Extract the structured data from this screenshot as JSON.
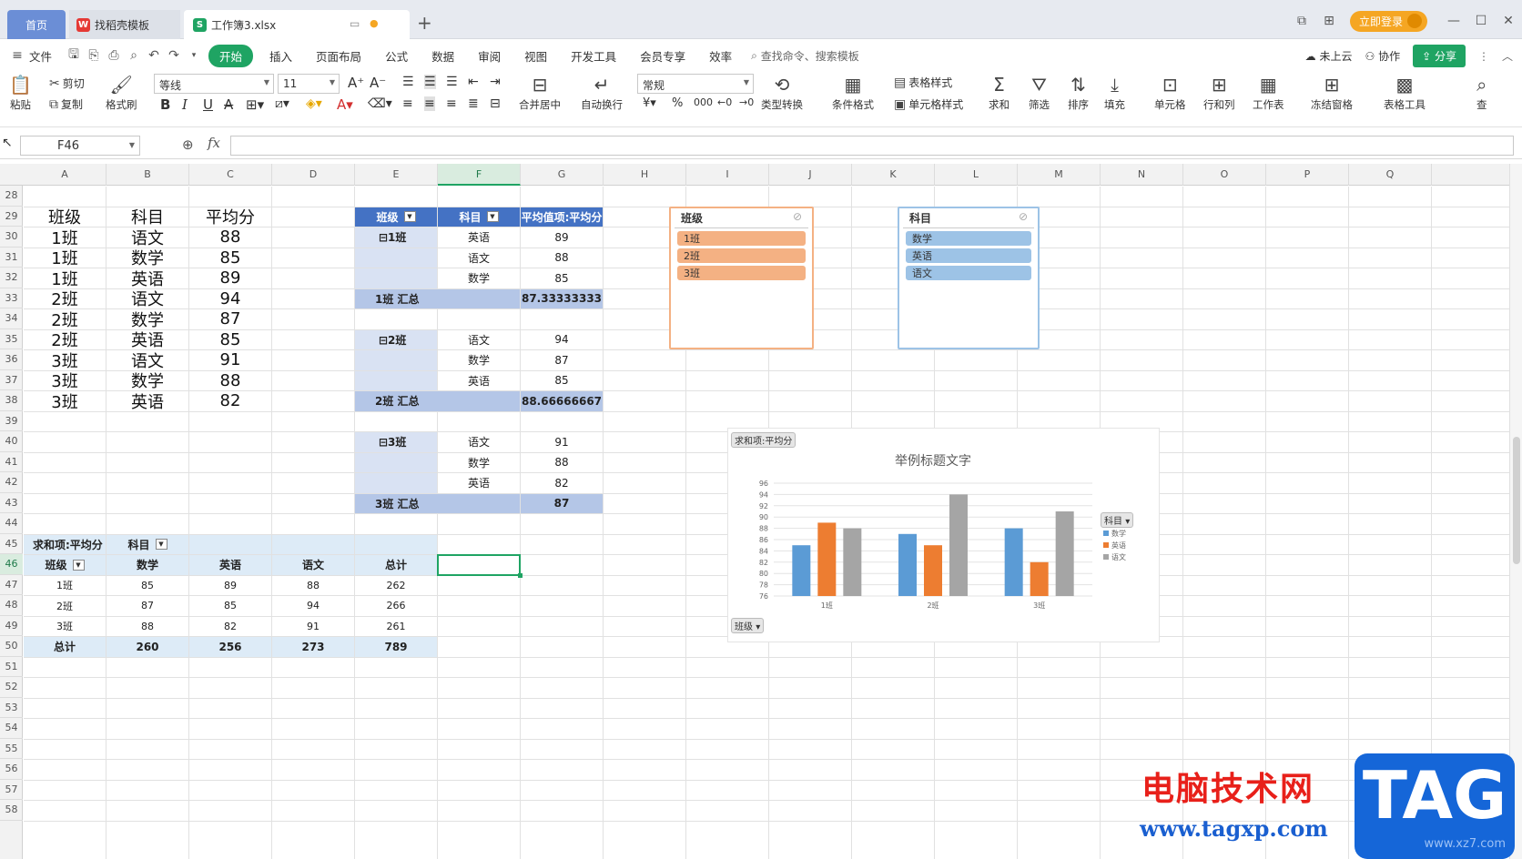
{
  "tabs": {
    "home": "首页",
    "templates": "找稻壳模板",
    "workbook": "工作簿3.xlsx",
    "unsaved_dot": "●",
    "add": "+"
  },
  "window": {
    "login": "立即登录"
  },
  "menu": {
    "file": "文件",
    "items": [
      "开始",
      "插入",
      "页面布局",
      "公式",
      "数据",
      "审阅",
      "视图",
      "开发工具",
      "会员专享",
      "效率"
    ],
    "search": "查找命令、搜索模板",
    "cloud": "未上云",
    "collab": "协作",
    "share": "分享"
  },
  "ribbon": {
    "paste": "粘贴",
    "cut": "剪切",
    "copy": "复制",
    "format_painter": "格式刷",
    "font": "等线",
    "size": "11",
    "number_format": "常规",
    "merge": "合并居中",
    "wrap": "自动换行",
    "convert": "类型转换",
    "cond_format": "条件格式",
    "table_style": "表格样式",
    "cell_style": "单元格样式",
    "sum": "求和",
    "filter": "筛选",
    "sort": "排序",
    "fill": "填充",
    "cell": "单元格",
    "row_col": "行和列",
    "sheet": "工作表",
    "freeze": "冻结窗格",
    "table_tools": "表格工具",
    "find": "查"
  },
  "formula_bar": {
    "name_box": "F46",
    "fx": "fx",
    "value": ""
  },
  "columns": [
    "A",
    "B",
    "C",
    "D",
    "E",
    "F",
    "G",
    "H",
    "I",
    "J",
    "K",
    "L",
    "M",
    "N",
    "O",
    "P",
    "Q"
  ],
  "selected_column": "F",
  "rows": [
    "28",
    "29",
    "30",
    "31",
    "32",
    "33",
    "34",
    "35",
    "36",
    "37",
    "38",
    "39",
    "40",
    "41",
    "42",
    "43",
    "44",
    "45",
    "46",
    "47",
    "48",
    "49",
    "50",
    "51",
    "52",
    "53",
    "54",
    "55",
    "56",
    "57",
    "58"
  ],
  "selected_row": "46",
  "source_table": {
    "headers": [
      "班级",
      "科目",
      "平均分"
    ],
    "rows": [
      [
        "1班",
        "语文",
        "88"
      ],
      [
        "1班",
        "数学",
        "85"
      ],
      [
        "1班",
        "英语",
        "89"
      ],
      [
        "2班",
        "语文",
        "94"
      ],
      [
        "2班",
        "数学",
        "87"
      ],
      [
        "2班",
        "英语",
        "85"
      ],
      [
        "3班",
        "语文",
        "91"
      ],
      [
        "3班",
        "数学",
        "88"
      ],
      [
        "3班",
        "英语",
        "82"
      ]
    ]
  },
  "pivot1": {
    "headers": [
      "班级",
      "科目",
      "平均值项:平均分"
    ],
    "groups": [
      {
        "label": "⊟1班",
        "items": [
          [
            "英语",
            "89"
          ],
          [
            "语文",
            "88"
          ],
          [
            "数学",
            "85"
          ]
        ],
        "total_label": "1班 汇总",
        "total": "87.33333333"
      },
      {
        "label": "⊟2班",
        "items": [
          [
            "语文",
            "94"
          ],
          [
            "数学",
            "87"
          ],
          [
            "英语",
            "85"
          ]
        ],
        "total_label": "2班 汇总",
        "total": "88.66666667"
      },
      {
        "label": "⊟3班",
        "items": [
          [
            "语文",
            "91"
          ],
          [
            "数学",
            "88"
          ],
          [
            "英语",
            "82"
          ]
        ],
        "total_label": "3班 汇总",
        "total": "87"
      }
    ]
  },
  "pivot2": {
    "value_label": "求和项:平均分",
    "col_field": "科目",
    "row_field": "班级",
    "col_headers": [
      "数学",
      "英语",
      "语文",
      "总计"
    ],
    "rows": [
      [
        "1班",
        "85",
        "89",
        "88",
        "262"
      ],
      [
        "2班",
        "87",
        "85",
        "94",
        "266"
      ],
      [
        "3班",
        "88",
        "82",
        "91",
        "261"
      ]
    ],
    "total_row": [
      "总计",
      "260",
      "256",
      "273",
      "789"
    ]
  },
  "slicer_class": {
    "title": "班级",
    "items": [
      "1班",
      "2班",
      "3班"
    ],
    "color": "#f4b183"
  },
  "slicer_subject": {
    "title": "科目",
    "items": [
      "数学",
      "英语",
      "语文"
    ],
    "color": "#9dc3e6"
  },
  "chart_data": {
    "type": "bar",
    "title": "举例标题文字",
    "value_field": "求和项:平均分",
    "axis_field": "班级",
    "legend_field": "科目",
    "legend_position": "right",
    "categories": [
      "1班",
      "2班",
      "3班"
    ],
    "series": [
      {
        "name": "数学",
        "color": "#5b9bd5",
        "values": [
          85,
          87,
          88
        ]
      },
      {
        "name": "英语",
        "color": "#ed7d31",
        "values": [
          89,
          85,
          82
        ]
      },
      {
        "name": "语文",
        "color": "#a5a5a5",
        "values": [
          88,
          94,
          91
        ]
      }
    ],
    "ylim": [
      76,
      96
    ],
    "yticks": [
      "96",
      "94",
      "92",
      "90",
      "88",
      "86",
      "84",
      "82",
      "80",
      "78",
      "76"
    ],
    "grid": true
  },
  "watermark": {
    "brand": "电脑技术网",
    "url": "www.tagxp.com",
    "logo": "TAG",
    "logo_sub": "www.xz7.com"
  }
}
